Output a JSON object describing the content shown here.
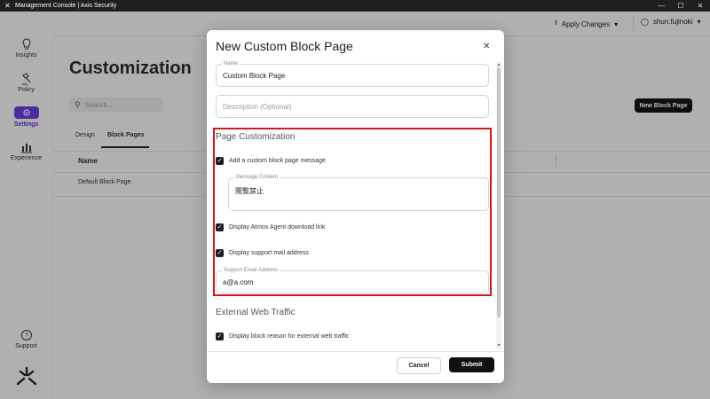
{
  "window": {
    "title": "Management Console | Axis Security"
  },
  "sidebar": {
    "items": [
      {
        "label": "Insights",
        "icon": "lightbulb-icon"
      },
      {
        "label": "Policy",
        "icon": "gavel-icon"
      },
      {
        "label": "Settings",
        "icon": "gear-icon",
        "active": true
      },
      {
        "label": "Experience",
        "icon": "bar-chart-icon"
      }
    ],
    "support": {
      "label": "Support",
      "icon": "question-icon"
    }
  },
  "topbar": {
    "apply_label": "Apply Changes",
    "user": "shun.fujinoki"
  },
  "main": {
    "title": "Customization",
    "search_placeholder": "Search...",
    "new_button": "New Block Page",
    "tabs": [
      {
        "label": "Design"
      },
      {
        "label": "Block Pages",
        "active": true
      }
    ],
    "table": {
      "headers": [
        "Name"
      ],
      "rows": [
        {
          "name": "Default Block Page"
        }
      ]
    }
  },
  "modal": {
    "title": "New Custom Block Page",
    "name_label": "Name",
    "name_value": "Custom Block Page",
    "description_placeholder": "Description (Optional)",
    "page_customization": {
      "title": "Page Customization",
      "custom_message_label": "Add a custom block page message",
      "message_content_label": "Message Content",
      "message_content_value": "閲覧禁止",
      "atmos_link_label": "Display Atmos Agent download link",
      "support_mail_label": "Display support mail address",
      "support_email_label": "Support Email Address",
      "support_email_value": "a@a.com"
    },
    "external_web_traffic": {
      "title": "External Web Traffic",
      "block_reason_label": "Display block reason for external web traffic"
    },
    "cancel_label": "Cancel",
    "submit_label": "Submit"
  },
  "colors": {
    "accent": "#6b3de0",
    "highlight": "#d4161b"
  }
}
